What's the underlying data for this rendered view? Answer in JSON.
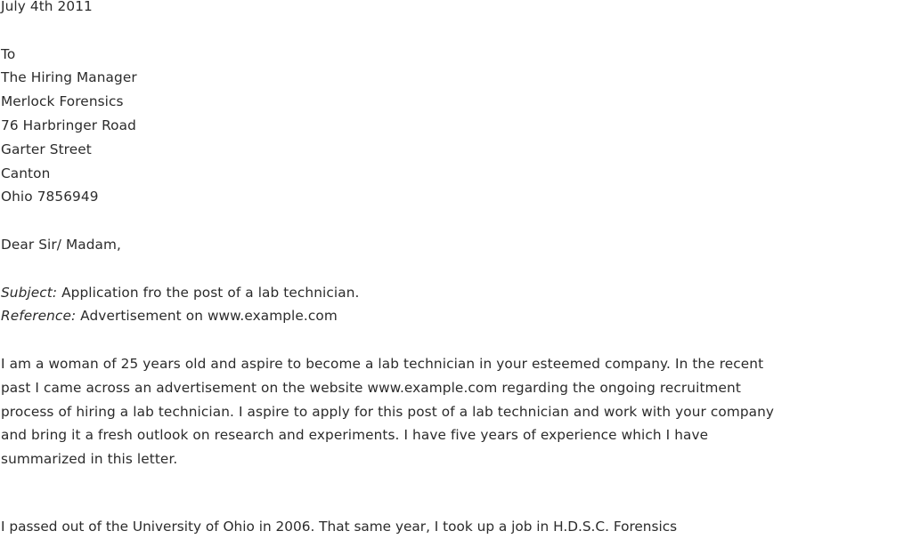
{
  "letter": {
    "date": "July 4th 2011",
    "recipient": {
      "to": "To",
      "lines": [
        "The Hiring Manager",
        "Merlock Forensics",
        "76 Harbringer Road",
        "Garter Street",
        "Canton",
        "Ohio 7856949"
      ]
    },
    "salutation": "Dear Sir/ Madam,",
    "subject": {
      "label": "Subject:",
      "text": " Application fro the post of a lab technician."
    },
    "reference": {
      "label": "Reference:",
      "text": " Advertisement on www.example.com"
    },
    "paragraph1": [
      "I am a woman of 25 years old and aspire to become a lab technician in your esteemed company. In the recent",
      "past I came across an advertisement on the website www.example.com regarding the ongoing recruitment",
      "process of hiring a lab technician. I aspire to apply for this post of a lab technician and work with your company",
      "and bring it a fresh outlook on research and experiments. I have five years of experience which I have",
      "summarized in this letter."
    ],
    "paragraph2_partial": "I passed out of the University of Ohio in 2006. That same year, I took up a job in H.D.S.C. Forensics"
  }
}
